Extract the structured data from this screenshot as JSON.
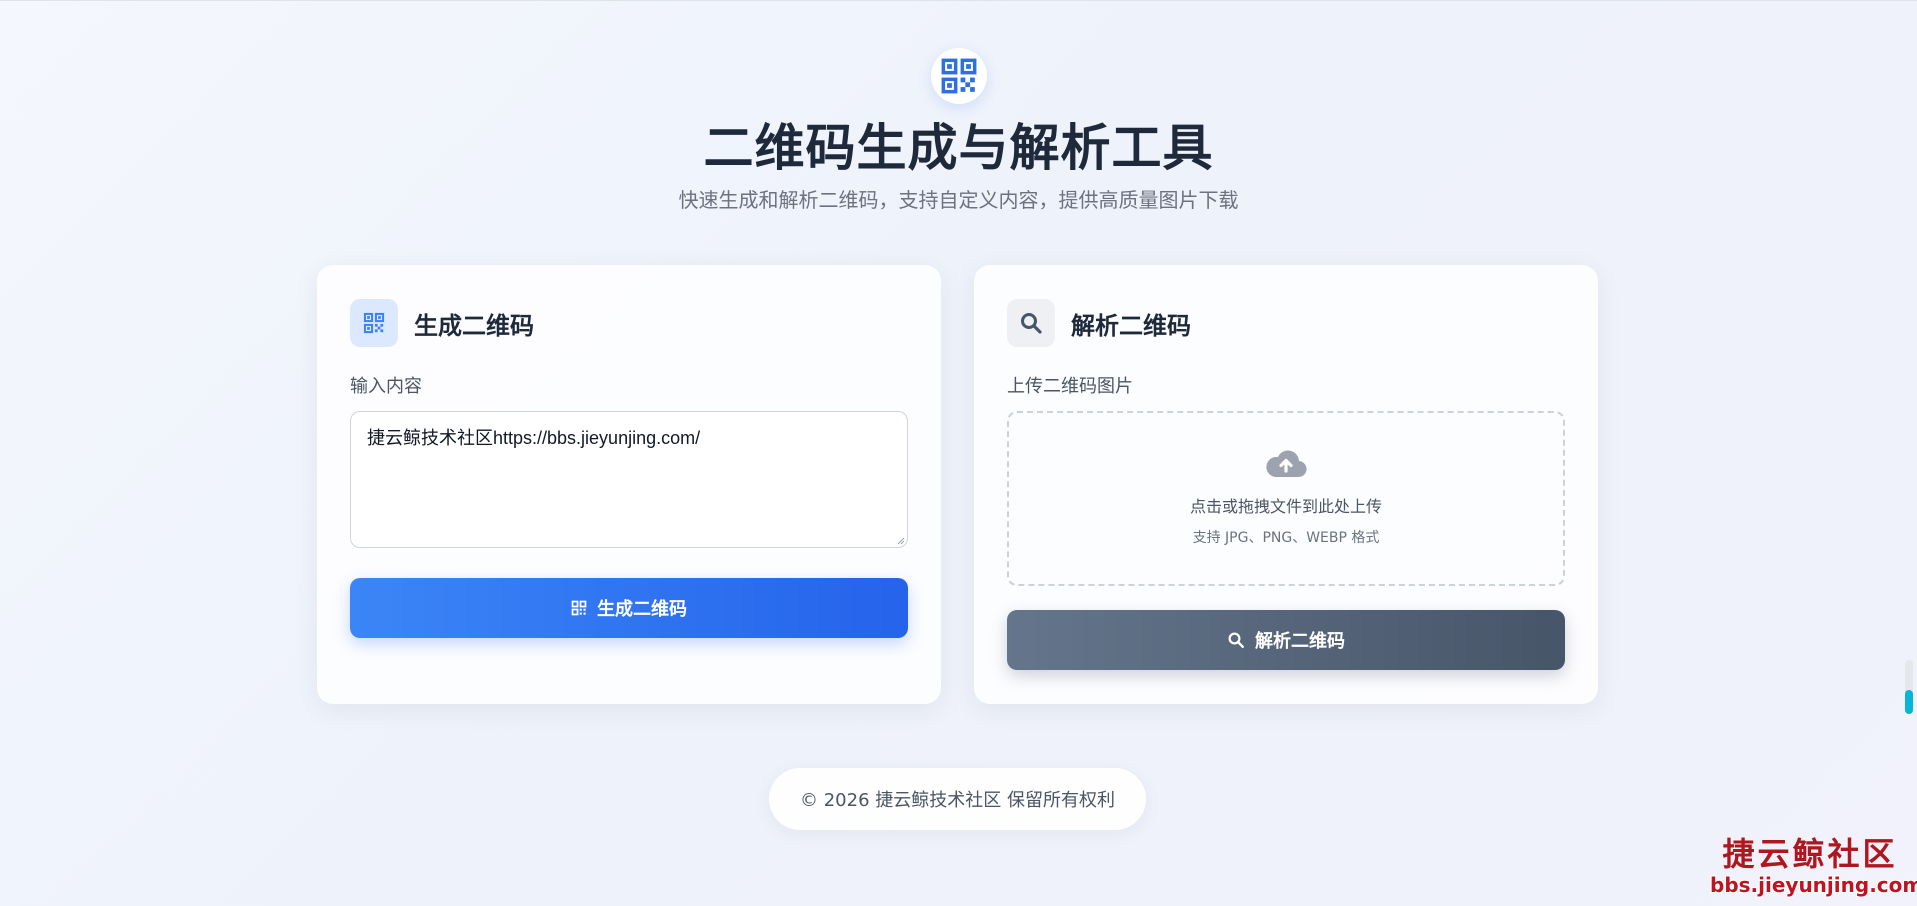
{
  "header": {
    "title": "二维码生成与解析工具",
    "subtitle": "快速生成和解析二维码，支持自定义内容，提供高质量图片下载",
    "logo_icon": "qr-code-icon"
  },
  "generate": {
    "title": "生成二维码",
    "icon": "qr-code-icon",
    "input_label": "输入内容",
    "input_value": "捷云鲸技术社区https://bbs.jieyunjing.com/",
    "button_label": "生成二维码",
    "button_icon": "qr-code-icon"
  },
  "parse": {
    "title": "解析二维码",
    "icon": "search-icon",
    "upload_label": "上传二维码图片",
    "upload_icon": "cloud-upload-icon",
    "upload_text": "点击或拖拽文件到此处上传",
    "upload_hint": "支持 JPG、PNG、WEBP 格式",
    "button_label": "解析二维码",
    "button_icon": "search-icon"
  },
  "footer": {
    "text": "© 2026 捷云鲸技术社区 保留所有权利"
  },
  "watermark": {
    "name": "捷云鲸社区",
    "url": "bbs.jieyunjing.com"
  },
  "colors": {
    "primary": "#3b82f6",
    "primary_dark": "#2563eb",
    "slate": "#475569",
    "title": "#1e2a3b",
    "muted": "#6b7280",
    "scroll_accent": "#06b6d4",
    "watermark_red": "#c1121f"
  }
}
